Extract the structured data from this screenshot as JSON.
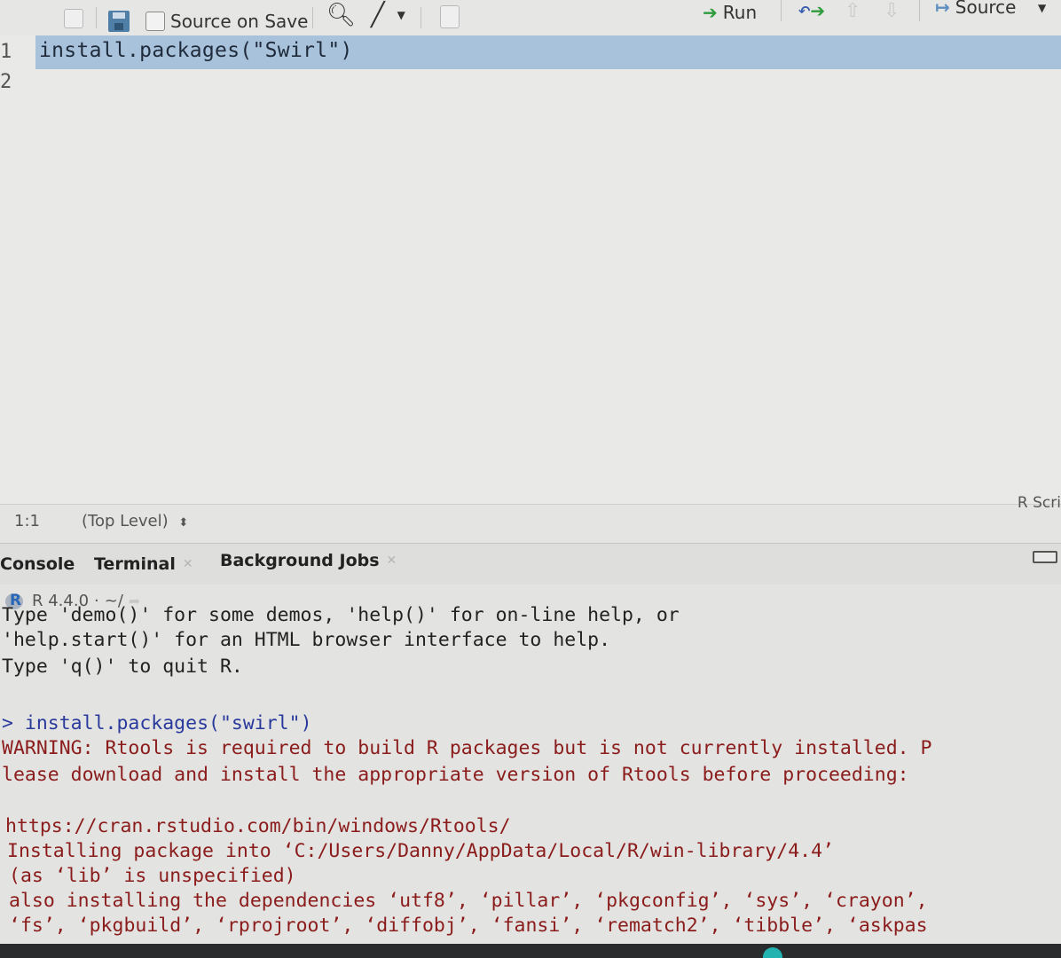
{
  "toolbar": {
    "source_on_save_label": "Source on Save",
    "source_on_save_checked": false,
    "run_label": "Run",
    "source_label": "Source",
    "icons": {
      "show_in_window": "show-in-new-window-icon",
      "save": "save-icon",
      "find": "search-icon",
      "code_tools": "magic-wand-icon",
      "compile_report": "notebook-icon",
      "rerun": "rerun-icon",
      "go_up": "arrow-up-icon",
      "go_down": "arrow-down-icon",
      "source_dropdown": "chevron-down-icon"
    }
  },
  "editor": {
    "line_numbers": [
      "1",
      "2"
    ],
    "lines": [
      "install.packages(\"Swirl\")",
      ""
    ],
    "highlight_color": "#a9c2dc"
  },
  "status_bar": {
    "cursor_position": "1:1",
    "scope": "(Top Level)",
    "scope_icon": "updown-icon",
    "file_type": "R Scri"
  },
  "console_tabs": [
    {
      "label": "Console",
      "closable": false,
      "active": true
    },
    {
      "label": "Terminal",
      "closable": true,
      "active": false
    },
    {
      "label": "Background Jobs",
      "closable": true,
      "active": false
    }
  ],
  "console": {
    "r_version": "R 4.4.0",
    "working_dir": "~/",
    "lines": [
      {
        "type": "output",
        "text": "Type 'demo()' for some demos, 'help()' for on-line help, or"
      },
      {
        "type": "output",
        "text": "'help.start()' for an HTML browser interface to help."
      },
      {
        "type": "output",
        "text": "Type 'q()' to quit R."
      },
      {
        "type": "blank",
        "text": ""
      },
      {
        "type": "input",
        "prompt": ">",
        "text": "install.packages(\"swirl\")"
      },
      {
        "type": "warn",
        "text": "WARNING: Rtools is required to build R packages but is not currently installed. P"
      },
      {
        "type": "warn",
        "text": "lease download and install the appropriate version of Rtools before proceeding:"
      },
      {
        "type": "blank",
        "text": ""
      },
      {
        "type": "warn",
        "text": "https://cran.rstudio.com/bin/windows/Rtools/"
      },
      {
        "type": "warn",
        "text": "Installing package into ‘C:/Users/Danny/AppData/Local/R/win-library/4.4’"
      },
      {
        "type": "warn",
        "text": "(as ‘lib’ is unspecified)"
      },
      {
        "type": "warn",
        "text": "also installing the dependencies ‘utf8’, ‘pillar’, ‘pkgconfig’, ‘sys’, ‘crayon’,"
      },
      {
        "type": "warn",
        "text": "‘fs’, ‘pkgbuild’, ‘rprojroot’, ‘diffobj’, ‘fansi’, ‘rematch2’, ‘tibble’, ‘askpas"
      }
    ],
    "colors": {
      "input": "#2a3a9c",
      "warn": "#8b1c1c",
      "output": "#222222"
    }
  }
}
